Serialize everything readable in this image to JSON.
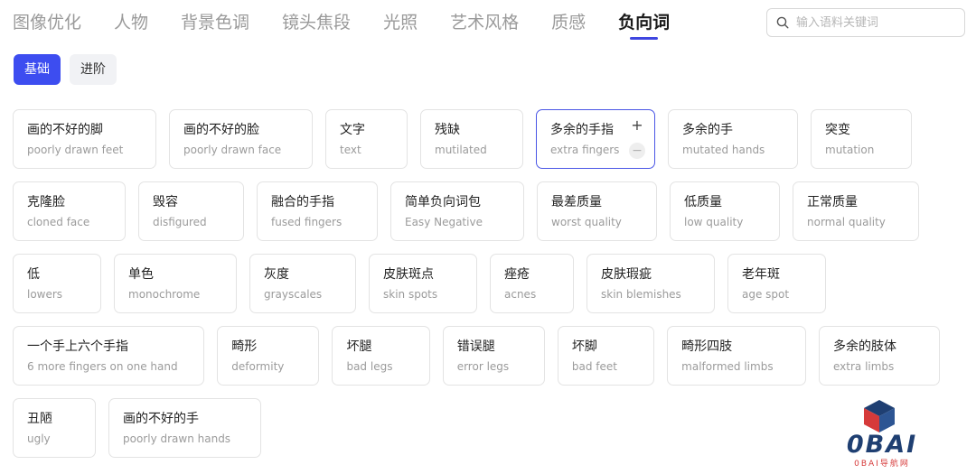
{
  "nav": {
    "tabs": [
      {
        "label": "图像优化"
      },
      {
        "label": "人物"
      },
      {
        "label": "背景色调"
      },
      {
        "label": "镜头焦段"
      },
      {
        "label": "光照"
      },
      {
        "label": "艺术风格"
      },
      {
        "label": "质感"
      },
      {
        "label": "负向词"
      }
    ],
    "active_index": 7
  },
  "search": {
    "placeholder": "输入语料关键词",
    "value": "",
    "icon": "search-icon"
  },
  "subtabs": [
    {
      "label": "基础"
    },
    {
      "label": "进阶"
    }
  ],
  "cards": [
    {
      "zh": "画的不好的脚",
      "en": "poorly drawn feet"
    },
    {
      "zh": "画的不好的脸",
      "en": "poorly drawn face"
    },
    {
      "zh": "文字",
      "en": "text"
    },
    {
      "zh": "残缺",
      "en": "mutilated"
    },
    {
      "zh": "多余的手指",
      "en": "extra fingers",
      "plus": "+",
      "minus": "−"
    },
    {
      "zh": "多余的手",
      "en": "mutated hands"
    },
    {
      "zh": "突变",
      "en": "mutation"
    },
    {
      "zh": "克隆脸",
      "en": "cloned face"
    },
    {
      "zh": "毁容",
      "en": "disfigured"
    },
    {
      "zh": "融合的手指",
      "en": "fused fingers"
    },
    {
      "zh": "简单负向词包",
      "en": "Easy Negative"
    },
    {
      "zh": "最差质量",
      "en": "worst quality"
    },
    {
      "zh": "低质量",
      "en": "low quality"
    },
    {
      "zh": "正常质量",
      "en": "normal quality"
    },
    {
      "zh": "低",
      "en": "lowers"
    },
    {
      "zh": "单色",
      "en": "monochrome"
    },
    {
      "zh": "灰度",
      "en": "grayscales"
    },
    {
      "zh": "皮肤斑点",
      "en": "skin spots"
    },
    {
      "zh": "痤疮",
      "en": "acnes"
    },
    {
      "zh": "皮肤瑕疵",
      "en": "skin blemishes"
    },
    {
      "zh": "老年斑",
      "en": "age spot"
    },
    {
      "zh": "一个手上六个手指",
      "en": "6 more fingers on one hand"
    },
    {
      "zh": "畸形",
      "en": "deformity"
    },
    {
      "zh": "坏腿",
      "en": "bad legs"
    },
    {
      "zh": "错误腿",
      "en": "error legs"
    },
    {
      "zh": "坏脚",
      "en": "bad feet"
    },
    {
      "zh": "畸形四肢",
      "en": "malformed limbs"
    },
    {
      "zh": "多余的肢体",
      "en": "extra limbs"
    },
    {
      "zh": "丑陋",
      "en": "ugly"
    },
    {
      "zh": "画的不好的手",
      "en": "poorly drawn hands"
    }
  ],
  "logo": {
    "text": "0BAI",
    "subtext": "0BAI导航网"
  },
  "colors": {
    "accent": "#3d4df0",
    "selected_border": "#4a56e6",
    "muted_text": "#9b9b9b",
    "logo_blue": "#1f3f72",
    "logo_red": "#d63a3a"
  }
}
